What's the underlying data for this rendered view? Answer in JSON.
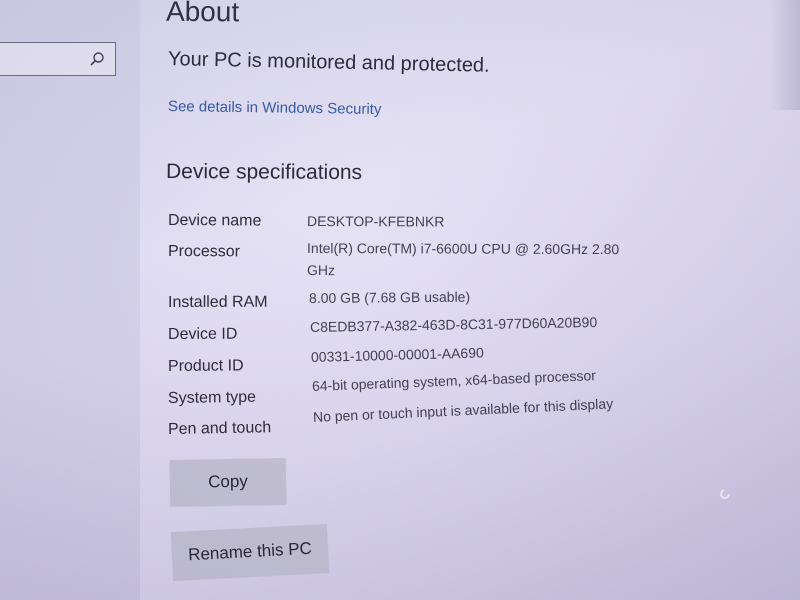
{
  "page": {
    "title": "About"
  },
  "security": {
    "status": "Your PC is monitored and protected.",
    "link": "See details in Windows Security"
  },
  "specs": {
    "heading": "Device specifications",
    "rows": [
      {
        "label": "Device name",
        "value": "DESKTOP-KFEBNKR"
      },
      {
        "label": "Processor",
        "value": "Intel(R) Core(TM) i7-6600U CPU @ 2.60GHz   2.80 GHz"
      },
      {
        "label": "Installed RAM",
        "value": "8.00 GB (7.68 GB usable)"
      },
      {
        "label": "Device ID",
        "value": "C8EDB377-A382-463D-8C31-977D60A20B90"
      },
      {
        "label": "Product ID",
        "value": "00331-10000-00001-AA690"
      },
      {
        "label": "System type",
        "value": "64-bit operating system, x64-based processor"
      },
      {
        "label": "Pen and touch",
        "value": "No pen or touch input is available for this display"
      }
    ]
  },
  "buttons": {
    "copy": "Copy",
    "rename": "Rename this PC"
  },
  "icons": {
    "search": "search-icon",
    "cursor": "busy-cursor-icon"
  },
  "colors": {
    "link": "#2c55a8",
    "button_bg": "#c4c2d4",
    "background": "#e6e2f6"
  }
}
